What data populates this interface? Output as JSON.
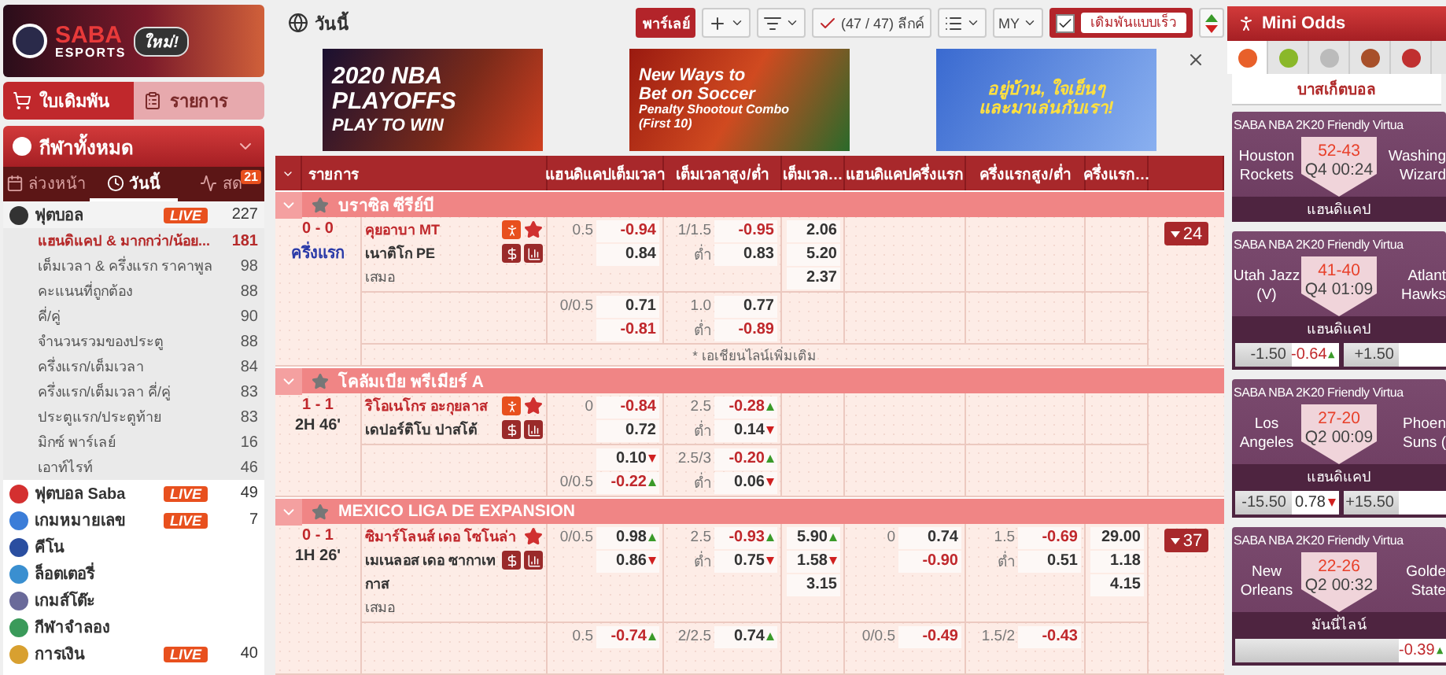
{
  "sidebar": {
    "logo": {
      "brand": "SABA",
      "sub": "ESPORTS",
      "badge": "ใหม่!"
    },
    "tabs": [
      {
        "label": "ใบเดิมพัน",
        "kind": "cart",
        "selected": true
      },
      {
        "label": "รายการ",
        "kind": "list",
        "selected": false
      }
    ],
    "sports_title": "กีฬาทั้งหมด",
    "period_tabs": [
      {
        "label": "ล่วงหน้า",
        "kind": "calendar",
        "selected": false
      },
      {
        "label": "วันนี้",
        "kind": "clock",
        "selected": true
      },
      {
        "label": "สด",
        "kind": "live",
        "selected": false,
        "badge": "21"
      }
    ],
    "sports": [
      {
        "name": "ฟุตบอล",
        "kind": "football",
        "badge": "LIVE",
        "count": "227",
        "expanded": true,
        "children": [
          {
            "label": "แฮนดิแคป & มากกว่า/น้อย...",
            "count": "181",
            "selected": true
          },
          {
            "label": "เต็มเวลา & ครึ่งแรก ราคาพูล",
            "count": "98",
            "selected": false
          },
          {
            "label": "คะแนนที่ถูกต้อง",
            "count": "88",
            "selected": false
          },
          {
            "label": "คี่/คู่",
            "count": "90",
            "selected": false
          },
          {
            "label": "จำนวนรวมของประตู",
            "count": "88",
            "selected": false
          },
          {
            "label": "ครึ่งแรก/เต็มเวลา",
            "count": "84",
            "selected": false
          },
          {
            "label": "ครึ่งแรก/เต็มเวลา คี่/คู่",
            "count": "83",
            "selected": false
          },
          {
            "label": "ประตูแรก/ประตูท้าย",
            "count": "83",
            "selected": false
          },
          {
            "label": "มิกซ์ พาร์เลย์",
            "count": "16",
            "selected": false
          },
          {
            "label": "เอาท์ไรท์",
            "count": "46",
            "selected": false
          }
        ]
      },
      {
        "name": "ฟุตบอล Saba",
        "kind": "saba",
        "badge": "LIVE",
        "count": "49",
        "expanded": false
      },
      {
        "name": "เกมหมายเลข",
        "kind": "number",
        "badge": "LIVE",
        "count": "7",
        "expanded": false
      },
      {
        "name": "คีโน",
        "kind": "keno",
        "expanded": false
      },
      {
        "name": "ล็อตเตอรี่",
        "kind": "lottery",
        "expanded": false
      },
      {
        "name": "เกมส์โต๊ะ",
        "kind": "table",
        "expanded": false
      },
      {
        "name": "กีฬาจำลอง",
        "kind": "virtual",
        "expanded": false
      },
      {
        "name": "การเงิน",
        "kind": "finance",
        "badge": "LIVE",
        "count": "40",
        "expanded": false
      }
    ]
  },
  "main": {
    "title": "วันนี้",
    "toolbar": {
      "parlay": "พาร์เลย์",
      "league_filter": "(47 / 47) ลีกค์",
      "odds_type": "MY",
      "quick_bet": {
        "label": "เดิมพันแบบเร็ว",
        "checked": true
      }
    },
    "banners": [
      {
        "kind": "nba",
        "lines": [
          "2020 NBA",
          "PLAYOFFS",
          "PLAY TO WIN"
        ]
      },
      {
        "kind": "soccer",
        "lines": [
          "New Ways to",
          "Bet on Soccer",
          "Penalty Shootout Combo",
          "(First 10)"
        ]
      },
      {
        "kind": "cartoon",
        "lines": [
          "อยู่บ้าน, ใจเย็นๆ",
          "และมาเล่นกับเรา!"
        ]
      }
    ],
    "table": {
      "columns": [
        "รายการ",
        "แฮนดิแคปเต็มเวลา",
        "เต็มเวลาสูง/ต่ำ",
        "เต็มเวล…",
        "แฮนดิแคปครึ่งแรก",
        "ครึ่งแรกสูง/ต่ำ",
        "ครึ่งแรก…"
      ],
      "leagues": [
        {
          "name": "บราซิล ซีรีย์บี",
          "matches": [
            {
              "score": "0 - 0",
              "time": "ครึ่งแรก",
              "kind": "pending",
              "more": "24",
              "more_lines": "* เอเชียนไลน์เพิ่มเติม",
              "teams": [
                {
                  "name": "คุยอาบา MT",
                  "favorite": true,
                  "stream": true,
                  "star": true
                },
                {
                  "name": "เนาติโก PE",
                  "favorite": false,
                  "cash": true,
                  "stats": true
                }
              ],
              "draw": "เสมอ",
              "lines": [
                {
                  "hdp": {
                    "home_line": "0.5",
                    "home": {
                      "value": "-0.94"
                    },
                    "away": {
                      "value": "0.84"
                    }
                  },
                  "ou": {
                    "line": "1/1.5",
                    "over": {
                      "value": "-0.95"
                    },
                    "under_label": "ต่ำ",
                    "under": {
                      "value": "0.83"
                    }
                  },
                  "x12": [
                    {
                      "value": "2.06"
                    },
                    {
                      "value": "5.20"
                    },
                    {
                      "value": "2.37"
                    }
                  ]
                },
                {
                  "hdp": {
                    "home_line": "0/0.5",
                    "home": {
                      "value": "0.71"
                    },
                    "away": {
                      "value": "-0.81"
                    }
                  },
                  "ou": {
                    "line": "1.0",
                    "over": {
                      "value": "0.77"
                    },
                    "under_label": "ต่ำ",
                    "under": {
                      "value": "-0.89"
                    }
                  }
                }
              ]
            }
          ]
        },
        {
          "name": "โคลัมเบีย พรีเมียร์ A",
          "matches": [
            {
              "score": "1 - 1",
              "time": "2H 46'",
              "kind": "live",
              "teams": [
                {
                  "name": "ริโอเนโกร อะกุยลาส",
                  "favorite": true,
                  "stream": true,
                  "star": true
                },
                {
                  "name": "เดปอร์ติโบ ปาสโต้",
                  "favorite": false,
                  "cash": true,
                  "stats": true
                }
              ],
              "lines": [
                {
                  "hdp": {
                    "home_line": "0",
                    "home": {
                      "value": "-0.84"
                    },
                    "away": {
                      "value": "0.72"
                    }
                  },
                  "ou": {
                    "line": "2.5",
                    "over": {
                      "value": "-0.28",
                      "rising": true
                    },
                    "under_label": "ต่ำ",
                    "under": {
                      "value": "0.14",
                      "rising": false
                    }
                  }
                },
                {
                  "hdp": {
                    "away_line": "0/0.5",
                    "home": {
                      "value": "0.10",
                      "rising": false
                    },
                    "away": {
                      "value": "-0.22",
                      "rising": true
                    }
                  },
                  "ou": {
                    "line": "2.5/3",
                    "over": {
                      "value": "-0.20",
                      "rising": true
                    },
                    "under_label": "ต่ำ",
                    "under": {
                      "value": "0.06",
                      "rising": false
                    }
                  }
                }
              ]
            }
          ]
        },
        {
          "name": "MEXICO LIGA DE EXPANSION",
          "matches": [
            {
              "score": "0 - 1",
              "time": "1H 26'",
              "kind": "live",
              "more": "37",
              "teams": [
                {
                  "name": "ซิมาร์โลนส์ เดอ โซโนล่า",
                  "favorite": true,
                  "star": true
                },
                {
                  "name": "เมเนลอส เดอ ซากาเทกาส",
                  "favorite": false,
                  "cash": true,
                  "stats": true
                }
              ],
              "draw": "เสมอ",
              "lines": [
                {
                  "hdp": {
                    "home_line": "0/0.5",
                    "home": {
                      "value": "0.98",
                      "rising": true
                    },
                    "away": {
                      "value": "0.86",
                      "rising": false
                    }
                  },
                  "ou": {
                    "line": "2.5",
                    "over": {
                      "value": "-0.93",
                      "rising": true
                    },
                    "under_label": "ต่ำ",
                    "under": {
                      "value": "0.75",
                      "rising": false
                    }
                  },
                  "x12": [
                    {
                      "value": "5.90",
                      "rising": true
                    },
                    {
                      "value": "1.58",
                      "rising": false
                    },
                    {
                      "value": "3.15"
                    }
                  ],
                  "hdp1h": {
                    "home_line": "0",
                    "home": {
                      "value": "0.74"
                    },
                    "away": {
                      "value": "-0.90"
                    }
                  },
                  "ou1h": {
                    "line": "1.5",
                    "over": {
                      "value": "-0.69"
                    },
                    "under_label": "ต่ำ",
                    "under": {
                      "value": "0.51"
                    }
                  },
                  "x121h": [
                    {
                      "value": "29.00"
                    },
                    {
                      "value": "1.18"
                    },
                    {
                      "value": "4.15"
                    }
                  ]
                },
                {
                  "hdp": {
                    "home_line": "0.5",
                    "home": {
                      "value": "-0.74",
                      "rising": true
                    }
                  },
                  "ou": {
                    "line": "2/2.5",
                    "over": {
                      "value": "0.74",
                      "rising": true
                    }
                  },
                  "hdp1h": {
                    "home_line": "0/0.5",
                    "home": {
                      "value": "-0.49"
                    }
                  },
                  "ou1h": {
                    "line": "1.5/2",
                    "over": {
                      "value": "-0.43"
                    }
                  }
                }
              ]
            }
          ]
        }
      ]
    }
  },
  "mini_odds": {
    "title": "Mini Odds",
    "sport_tabs": [
      {
        "kind": "basketball",
        "selected": true
      },
      {
        "kind": "tennis",
        "selected": false
      },
      {
        "kind": "baseball",
        "selected": false
      },
      {
        "kind": "football",
        "selected": false
      },
      {
        "kind": "helmet",
        "selected": false
      }
    ],
    "sport_label": "บาสเก็ตบอล",
    "cards": [
      {
        "title": "SABA NBA 2K20 Friendly Virtua",
        "home": "Houston Rockets",
        "score": "52-43",
        "time": "Q4 00:24",
        "away": "Washing Wizard",
        "market": "แฮนดิแคป"
      },
      {
        "title": "SABA NBA 2K20 Friendly Virtua",
        "home": "Utah Jazz (V)",
        "score": "41-40",
        "time": "Q4 01:09",
        "away": "Atlant Hawks",
        "market": "แฮนดิแคป",
        "odds": [
          {
            "line": "-1.50",
            "value": "-0.64",
            "rising": true
          },
          {
            "line": "+1.50"
          }
        ]
      },
      {
        "title": "SABA NBA 2K20 Friendly Virtua",
        "home": "Los Angeles",
        "score": "27-20",
        "time": "Q2 00:09",
        "away": "Phoen Suns (",
        "market": "แฮนดิแคป",
        "odds": [
          {
            "line": "-15.50",
            "value": "0.78",
            "rising": false
          },
          {
            "line": "+15.50"
          }
        ]
      },
      {
        "title": "SABA NBA 2K20 Friendly Virtua",
        "home": "New Orleans",
        "score": "22-26",
        "time": "Q2 00:32",
        "away": "Golde State",
        "market": "มันนี่ไลน์",
        "odds": [
          {
            "value": "-0.39",
            "rising": true
          }
        ]
      }
    ]
  }
}
